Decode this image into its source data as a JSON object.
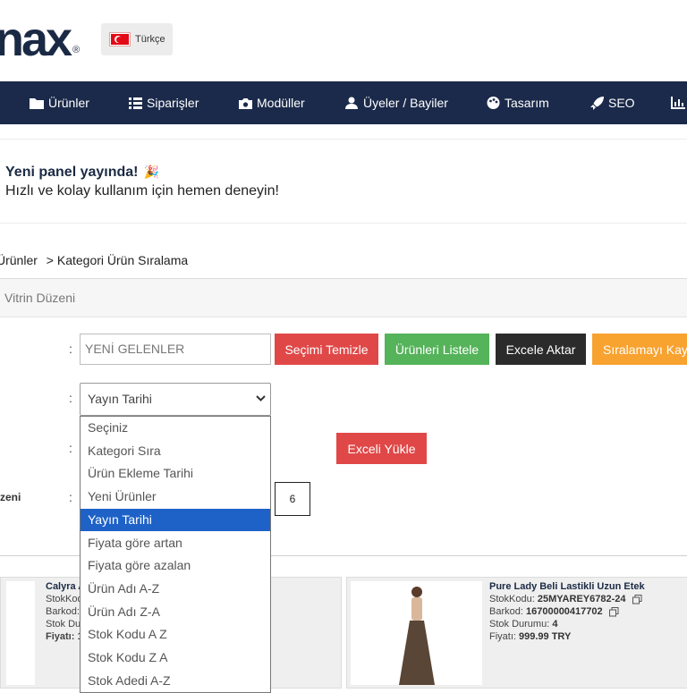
{
  "header": {
    "logo_text": "nax",
    "logo_mark": "®",
    "language": "Türkçe"
  },
  "nav": {
    "items": [
      {
        "label": "Ürünler",
        "icon": "folder-icon"
      },
      {
        "label": "Siparişler",
        "icon": "list-icon"
      },
      {
        "label": "Modüller",
        "icon": "camera-icon"
      },
      {
        "label": "Üyeler / Bayiler",
        "icon": "users-icon"
      },
      {
        "label": "Tasarım",
        "icon": "palette-icon"
      },
      {
        "label": "SEO",
        "icon": "rocket-icon"
      }
    ]
  },
  "announcement": {
    "title": "Yeni panel yayında!",
    "subtitle": "Hızlı ve kolay kullanım için hemen deneyin!"
  },
  "breadcrumb": {
    "parent": "Ürünler",
    "separator": ">",
    "current": "Kategori Ürün Sıralama"
  },
  "panel": {
    "title": "Vitrin Düzeni",
    "colon": ":",
    "category_input_value": "YENİ GELENLER",
    "buttons": {
      "clear": "Seçimi Temizle",
      "list": "Ürünleri Listele",
      "export": "Excele Aktar",
      "save_sort": "Sıralamayı Kaydet",
      "upload": "Exceli Yükle"
    },
    "sort_select_value": "Yayın Tarihi",
    "row_label_partial": "zeni",
    "per_row_value": "6"
  },
  "dropdown": {
    "selected_index": 4,
    "options": [
      "Seçiniz",
      "Kategori Sıra",
      "Ürün Ekleme Tarihi",
      "Yeni Ürünler",
      "Yayın Tarihi",
      "Fiyata göre artan",
      "Fiyata göre azalan",
      "Ürün Adı A-Z",
      "Ürün Adı Z-A",
      "Stok Kodu A Z",
      "Stok Kodu Z A",
      "Stok Adedi A-Z"
    ]
  },
  "products": {
    "left_card": {
      "name": "Calyra A",
      "stock_code_label": "StokKod",
      "barcode_label": "Barkod:",
      "stock_status_label": "Stok Du",
      "price_label": "Fiyatı: 1"
    },
    "right_card": {
      "name": "Pure Lady Beli Lastikli Uzun Etek",
      "stock_code_label": "StokKodu:",
      "stock_code": "25MYAREY6782-24",
      "barcode_label": "Barkod:",
      "barcode": "16700000417702",
      "stock_status_label": "Stok Durumu:",
      "stock_status": "4",
      "price_label": "Fiyatı:",
      "price": "999.99 TRY"
    }
  },
  "colors": {
    "nav_bg": "#1b2a4a",
    "btn_red": "#e04848",
    "btn_green": "#55b35a",
    "btn_dark": "#2b2b2b",
    "btn_orange": "#f8a230",
    "select_highlight": "#1e62c8"
  }
}
